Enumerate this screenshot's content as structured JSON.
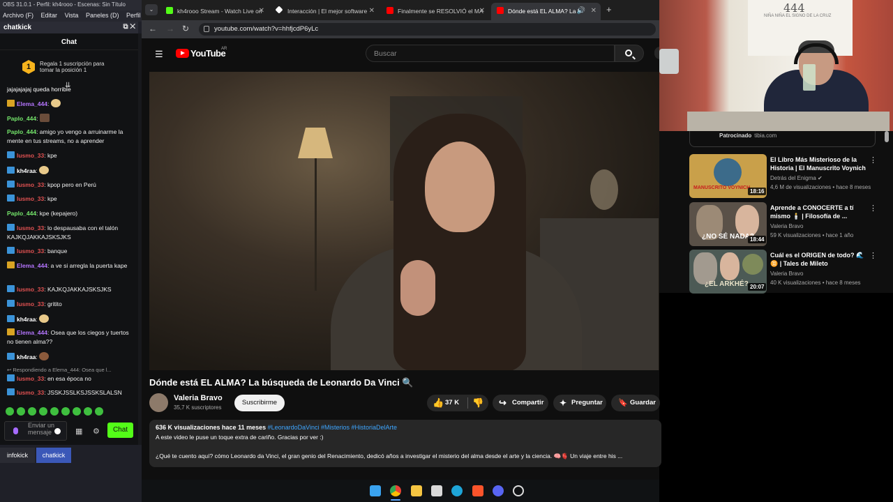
{
  "obs": {
    "title": "OBS 31.0.1 - Perfil: kh4rooo - Escenas: Sin Título",
    "menu": [
      "Archivo (F)",
      "Editar",
      "Vista",
      "Paneles (D)",
      "Perfil"
    ],
    "dock_title": "chatkick",
    "chat_header": "Chat",
    "gift_badge": "1",
    "gift_text": "Regala 1 suscripción para tomar la posición 1",
    "messages": [
      {
        "user": "",
        "text": "jajajajajaj queda horrible",
        "ucolor": "w"
      },
      {
        "user": "Elema_444",
        "text": ":",
        "ucolor": "p",
        "icon": "gold"
      },
      {
        "user": "Paplo_444",
        "text": ":",
        "ucolor": "g"
      },
      {
        "user": "Paplo_444",
        "text": ": amigo yo vengo a arruinarme la mente en tus streams, no a aprender",
        "ucolor": "g"
      },
      {
        "user": "lusmo_33",
        "text": ": kpe",
        "ucolor": "r",
        "icon": "blue"
      },
      {
        "user": "kh4raa",
        "text": ":",
        "ucolor": "w",
        "icon": "blue"
      },
      {
        "user": "lusmo_33",
        "text": ": kpop pero en Perú",
        "ucolor": "r",
        "icon": "blue"
      },
      {
        "user": "lusmo_33",
        "text": ": kpe",
        "ucolor": "r",
        "icon": "blue"
      },
      {
        "user": "Paplo_444",
        "text": ": kpe (kepajero)",
        "ucolor": "g"
      },
      {
        "user": "lusmo_33",
        "text": ": lo despausaba con el talón KAJKQJAKKAJSKSJKS",
        "ucolor": "r",
        "icon": "blue"
      },
      {
        "user": "lusmo_33",
        "text": ": banque",
        "ucolor": "r",
        "icon": "blue"
      },
      {
        "user": "Elema_444",
        "text": ": a ve si arregla la puerta kape",
        "ucolor": "p",
        "icon": "gold"
      },
      {
        "user": "lusmo_33",
        "text": ": KAJKQJAKKAJSKSJKS",
        "ucolor": "r",
        "icon": "blue"
      },
      {
        "user": "lusmo_33",
        "text": ": gritito",
        "ucolor": "r",
        "icon": "blue"
      },
      {
        "user": "kh4raa",
        "text": ":",
        "ucolor": "w",
        "icon": "blue"
      },
      {
        "user": "Elema_444",
        "text": ": Osea que los ciegos y tuertos no tienen alma??",
        "ucolor": "p",
        "icon": "gold"
      },
      {
        "user": "kh4raa",
        "text": ":",
        "ucolor": "w",
        "icon": "blue"
      },
      {
        "user": "",
        "text": "Respondiendo a Elema_444: Osea que l...",
        "ucolor": "w"
      },
      {
        "user": "lusmo_33",
        "text": ": en esa época no",
        "ucolor": "r",
        "icon": "blue"
      },
      {
        "user": "lusmo_33",
        "text": ": JSSKJSSLKSJSSKSLALSN",
        "ucolor": "r",
        "icon": "blue"
      }
    ],
    "send_placeholder": "Enviar un mensaje",
    "chat_button": "Chat",
    "bottom_tabs": [
      "infokick",
      "chatkick"
    ]
  },
  "browser": {
    "tabs": [
      {
        "label": "kh4rooo Stream - Watch Live on",
        "fav_color": "#53fc18"
      },
      {
        "label": "Interacción | El mejor software",
        "fav_color": "#ffffff"
      },
      {
        "label": "Finalmente se RESOLVIÓ el MA",
        "fav_color": "#ff0000"
      },
      {
        "label": "Dónde está EL ALMA? La b",
        "fav_color": "#ff0000"
      }
    ],
    "new_tab": "+",
    "url": "youtube.com/watch?v=hhfjcdP6yLc"
  },
  "youtube": {
    "logo": "YouTube",
    "region": "AR",
    "search_placeholder": "Buscar",
    "video_title": "Dónde está EL ALMA? La búsqueda de Leonardo Da Vinci 🔍",
    "channel": "Valeria Bravo",
    "subscribers": "35,7 K suscriptores",
    "subscribe": "Suscribirme",
    "likes": "37 K",
    "share": "Compartir",
    "ask": "Preguntar",
    "save": "Guardar",
    "views_line": "636 K visualizaciones  hace 11 meses",
    "tags": "#LeonardoDaVinci #Misterios #HistoriaDelArte",
    "desc_line1": "A este video le puse un toque extra de cariño. Gracias por ver :)",
    "desc_line2": "¿Qué te cuento aquí? cómo Leonardo da Vinci, el gran genio del Renacimiento, dedicó años a investigar el misterio del alma desde el arte y la ciencia. 🧠🫀 Un viaje entre his ..."
  },
  "webcam": {
    "board_number": "444",
    "board_scribble": "NIÑA NIÑA EL SIGNO DE LA CRUZ"
  },
  "related": {
    "sponsor": "Patrocinado",
    "sponsor_site": "tibia.com",
    "videos": [
      {
        "title": "El Libro Más Misterioso de la Historia | El Manuscrito Voynich",
        "channel": "Detrás del Enigma ✔",
        "meta": "4,6 M de visualizaciones • hace 8 meses",
        "duration": "18:16",
        "thumb_text": "MANUSCRITO VOYNICH",
        "bg": "#c9a04a"
      },
      {
        "title": "Aprende a CONOCERTE a tí mismo 🕯️ | Filosofía de ...",
        "channel": "Valeria Bravo",
        "meta": "59 K visualizaciones • hace 1 año",
        "duration": "18:44",
        "thumb_text": "¿NO SÉ NADA?",
        "bg": "#5a5148"
      },
      {
        "title": "Cuál es el ORIGEN de todo? 🌊 ♊ | Tales de Mileto",
        "channel": "Valeria Bravo",
        "meta": "40 K visualizaciones • hace 8 meses",
        "duration": "20:07",
        "thumb_text": "¿EL ARKHÉ?",
        "bg": "#4c5a55"
      }
    ]
  }
}
